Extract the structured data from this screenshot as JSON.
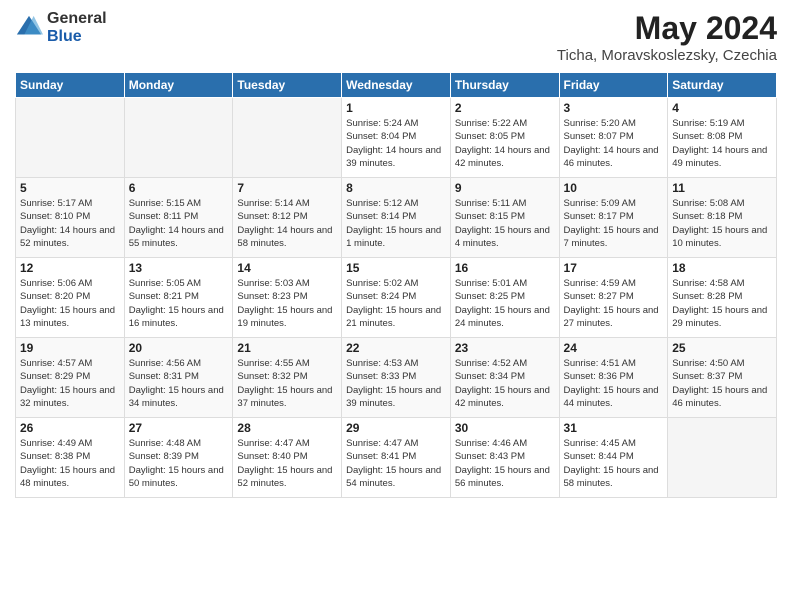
{
  "logo": {
    "general": "General",
    "blue": "Blue"
  },
  "title": "May 2024",
  "subtitle": "Ticha, Moravskoslezsky, Czechia",
  "days_of_week": [
    "Sunday",
    "Monday",
    "Tuesday",
    "Wednesday",
    "Thursday",
    "Friday",
    "Saturday"
  ],
  "weeks": [
    [
      {
        "day": "",
        "sunrise": "",
        "sunset": "",
        "daylight": ""
      },
      {
        "day": "",
        "sunrise": "",
        "sunset": "",
        "daylight": ""
      },
      {
        "day": "",
        "sunrise": "",
        "sunset": "",
        "daylight": ""
      },
      {
        "day": "1",
        "sunrise": "Sunrise: 5:24 AM",
        "sunset": "Sunset: 8:04 PM",
        "daylight": "Daylight: 14 hours and 39 minutes."
      },
      {
        "day": "2",
        "sunrise": "Sunrise: 5:22 AM",
        "sunset": "Sunset: 8:05 PM",
        "daylight": "Daylight: 14 hours and 42 minutes."
      },
      {
        "day": "3",
        "sunrise": "Sunrise: 5:20 AM",
        "sunset": "Sunset: 8:07 PM",
        "daylight": "Daylight: 14 hours and 46 minutes."
      },
      {
        "day": "4",
        "sunrise": "Sunrise: 5:19 AM",
        "sunset": "Sunset: 8:08 PM",
        "daylight": "Daylight: 14 hours and 49 minutes."
      }
    ],
    [
      {
        "day": "5",
        "sunrise": "Sunrise: 5:17 AM",
        "sunset": "Sunset: 8:10 PM",
        "daylight": "Daylight: 14 hours and 52 minutes."
      },
      {
        "day": "6",
        "sunrise": "Sunrise: 5:15 AM",
        "sunset": "Sunset: 8:11 PM",
        "daylight": "Daylight: 14 hours and 55 minutes."
      },
      {
        "day": "7",
        "sunrise": "Sunrise: 5:14 AM",
        "sunset": "Sunset: 8:12 PM",
        "daylight": "Daylight: 14 hours and 58 minutes."
      },
      {
        "day": "8",
        "sunrise": "Sunrise: 5:12 AM",
        "sunset": "Sunset: 8:14 PM",
        "daylight": "Daylight: 15 hours and 1 minute."
      },
      {
        "day": "9",
        "sunrise": "Sunrise: 5:11 AM",
        "sunset": "Sunset: 8:15 PM",
        "daylight": "Daylight: 15 hours and 4 minutes."
      },
      {
        "day": "10",
        "sunrise": "Sunrise: 5:09 AM",
        "sunset": "Sunset: 8:17 PM",
        "daylight": "Daylight: 15 hours and 7 minutes."
      },
      {
        "day": "11",
        "sunrise": "Sunrise: 5:08 AM",
        "sunset": "Sunset: 8:18 PM",
        "daylight": "Daylight: 15 hours and 10 minutes."
      }
    ],
    [
      {
        "day": "12",
        "sunrise": "Sunrise: 5:06 AM",
        "sunset": "Sunset: 8:20 PM",
        "daylight": "Daylight: 15 hours and 13 minutes."
      },
      {
        "day": "13",
        "sunrise": "Sunrise: 5:05 AM",
        "sunset": "Sunset: 8:21 PM",
        "daylight": "Daylight: 15 hours and 16 minutes."
      },
      {
        "day": "14",
        "sunrise": "Sunrise: 5:03 AM",
        "sunset": "Sunset: 8:23 PM",
        "daylight": "Daylight: 15 hours and 19 minutes."
      },
      {
        "day": "15",
        "sunrise": "Sunrise: 5:02 AM",
        "sunset": "Sunset: 8:24 PM",
        "daylight": "Daylight: 15 hours and 21 minutes."
      },
      {
        "day": "16",
        "sunrise": "Sunrise: 5:01 AM",
        "sunset": "Sunset: 8:25 PM",
        "daylight": "Daylight: 15 hours and 24 minutes."
      },
      {
        "day": "17",
        "sunrise": "Sunrise: 4:59 AM",
        "sunset": "Sunset: 8:27 PM",
        "daylight": "Daylight: 15 hours and 27 minutes."
      },
      {
        "day": "18",
        "sunrise": "Sunrise: 4:58 AM",
        "sunset": "Sunset: 8:28 PM",
        "daylight": "Daylight: 15 hours and 29 minutes."
      }
    ],
    [
      {
        "day": "19",
        "sunrise": "Sunrise: 4:57 AM",
        "sunset": "Sunset: 8:29 PM",
        "daylight": "Daylight: 15 hours and 32 minutes."
      },
      {
        "day": "20",
        "sunrise": "Sunrise: 4:56 AM",
        "sunset": "Sunset: 8:31 PM",
        "daylight": "Daylight: 15 hours and 34 minutes."
      },
      {
        "day": "21",
        "sunrise": "Sunrise: 4:55 AM",
        "sunset": "Sunset: 8:32 PM",
        "daylight": "Daylight: 15 hours and 37 minutes."
      },
      {
        "day": "22",
        "sunrise": "Sunrise: 4:53 AM",
        "sunset": "Sunset: 8:33 PM",
        "daylight": "Daylight: 15 hours and 39 minutes."
      },
      {
        "day": "23",
        "sunrise": "Sunrise: 4:52 AM",
        "sunset": "Sunset: 8:34 PM",
        "daylight": "Daylight: 15 hours and 42 minutes."
      },
      {
        "day": "24",
        "sunrise": "Sunrise: 4:51 AM",
        "sunset": "Sunset: 8:36 PM",
        "daylight": "Daylight: 15 hours and 44 minutes."
      },
      {
        "day": "25",
        "sunrise": "Sunrise: 4:50 AM",
        "sunset": "Sunset: 8:37 PM",
        "daylight": "Daylight: 15 hours and 46 minutes."
      }
    ],
    [
      {
        "day": "26",
        "sunrise": "Sunrise: 4:49 AM",
        "sunset": "Sunset: 8:38 PM",
        "daylight": "Daylight: 15 hours and 48 minutes."
      },
      {
        "day": "27",
        "sunrise": "Sunrise: 4:48 AM",
        "sunset": "Sunset: 8:39 PM",
        "daylight": "Daylight: 15 hours and 50 minutes."
      },
      {
        "day": "28",
        "sunrise": "Sunrise: 4:47 AM",
        "sunset": "Sunset: 8:40 PM",
        "daylight": "Daylight: 15 hours and 52 minutes."
      },
      {
        "day": "29",
        "sunrise": "Sunrise: 4:47 AM",
        "sunset": "Sunset: 8:41 PM",
        "daylight": "Daylight: 15 hours and 54 minutes."
      },
      {
        "day": "30",
        "sunrise": "Sunrise: 4:46 AM",
        "sunset": "Sunset: 8:43 PM",
        "daylight": "Daylight: 15 hours and 56 minutes."
      },
      {
        "day": "31",
        "sunrise": "Sunrise: 4:45 AM",
        "sunset": "Sunset: 8:44 PM",
        "daylight": "Daylight: 15 hours and 58 minutes."
      },
      {
        "day": "",
        "sunrise": "",
        "sunset": "",
        "daylight": ""
      }
    ]
  ]
}
